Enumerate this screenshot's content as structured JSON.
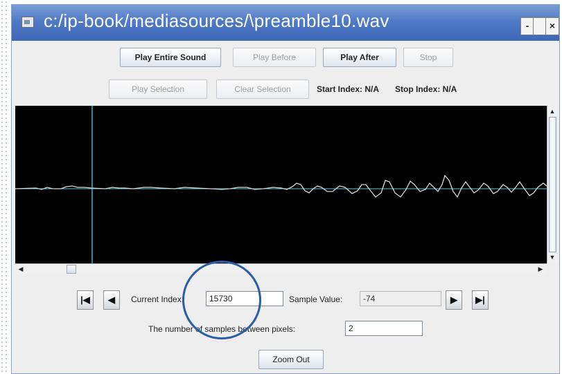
{
  "window": {
    "title": "c:/ip-book/mediasources/\\preamble10.wav",
    "controls": {
      "minimize": "-",
      "maximize": "",
      "close": "×"
    }
  },
  "toolbar_row1": {
    "play_entire": "Play Entire Sound",
    "play_before": "Play Before",
    "play_after": "Play After",
    "stop": "Stop"
  },
  "toolbar_row2": {
    "play_selection": "Play Selection",
    "clear_selection": "Clear Selection",
    "start_index": "Start Index: N/A",
    "stop_index": "Stop Index: N/A"
  },
  "waveform": {
    "background": "#000000",
    "cursor_color": "#4fb3c8",
    "wave_color": "#d8d8d8",
    "baseline_color": "#5fc6d8"
  },
  "navigation": {
    "first_icon": "skip-to-start-icon",
    "prev_icon": "step-back-icon",
    "next_icon": "step-forward-icon",
    "last_icon": "skip-to-end-icon",
    "current_index_label": "Current Index:",
    "current_index_value": "15730",
    "sample_value_label": "Sample Value:",
    "sample_value": "-74"
  },
  "zoom": {
    "samples_label": "The number of samples between pixels:",
    "samples_value": "2",
    "zoom_out": "Zoom Out"
  },
  "annotation": {
    "circle_color": "#2a5da8"
  }
}
